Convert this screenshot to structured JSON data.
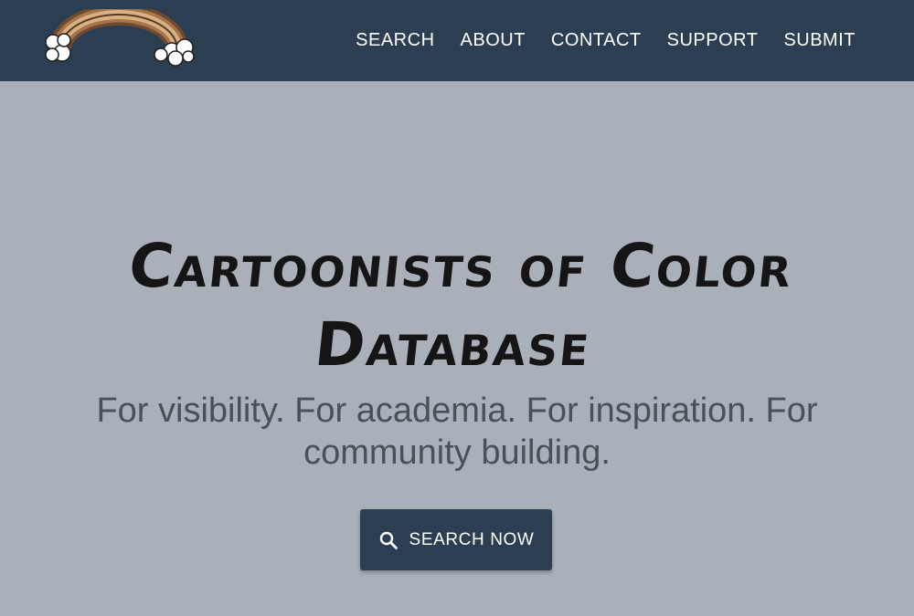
{
  "nav": {
    "items": [
      {
        "label": "SEARCH"
      },
      {
        "label": "ABOUT"
      },
      {
        "label": "CONTACT"
      },
      {
        "label": "SUPPORT"
      },
      {
        "label": "SUBMIT"
      }
    ]
  },
  "hero": {
    "title_line1": "Cartoonists of Color",
    "title_line2": "Database",
    "subtitle": "For visibility. For academia. For inspiration. For community building.",
    "button_label": "SEARCH NOW",
    "button_icon": "search-icon"
  },
  "colors": {
    "navbar": "#2b3e52",
    "background": "#a9b0ba",
    "button": "#2b3e52",
    "title": "#151515",
    "subtitle": "#4a5058"
  },
  "logo": {
    "icon": "rainbow-logo-icon"
  }
}
